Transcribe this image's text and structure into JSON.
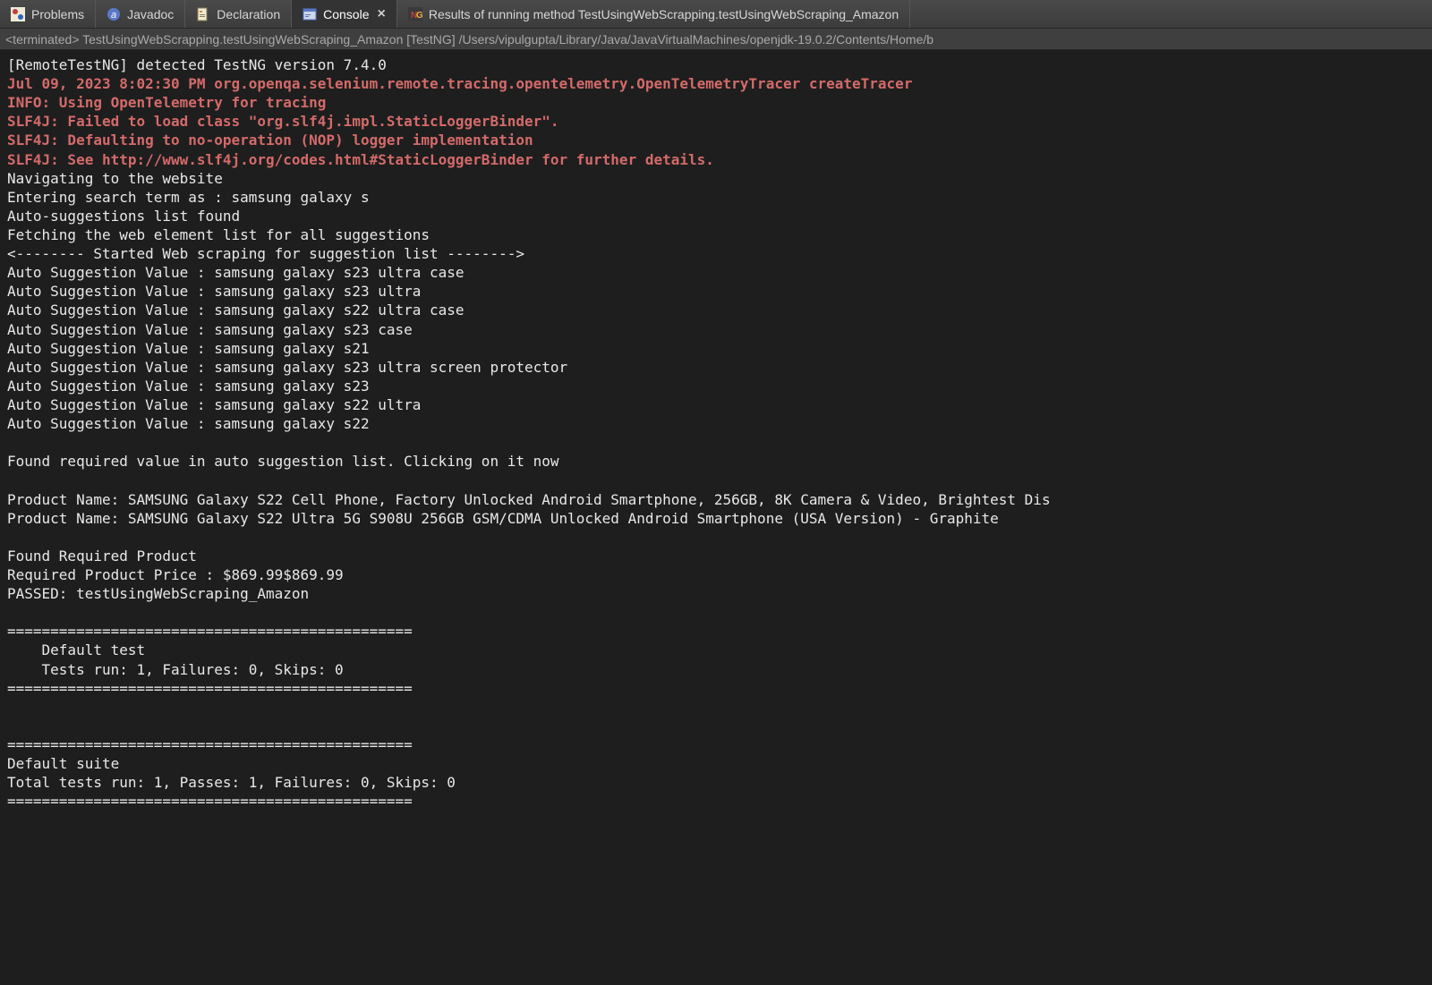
{
  "tabs": {
    "problems": {
      "label": "Problems"
    },
    "javadoc": {
      "label": "Javadoc"
    },
    "declaration": {
      "label": "Declaration"
    },
    "console": {
      "label": "Console"
    },
    "results": {
      "label": "Results of running method TestUsingWebScrapping.testUsingWebScraping_Amazon"
    }
  },
  "status": "<terminated> TestUsingWebScrapping.testUsingWebScraping_Amazon [TestNG] /Users/vipulgupta/Library/Java/JavaVirtualMachines/openjdk-19.0.2/Contents/Home/b",
  "console": {
    "lines": [
      {
        "cls": "white",
        "text": "[RemoteTestNG] detected TestNG version 7.4.0"
      },
      {
        "cls": "red",
        "text": "Jul 09, 2023 8:02:30 PM org.openqa.selenium.remote.tracing.opentelemetry.OpenTelemetryTracer createTracer"
      },
      {
        "cls": "red",
        "text": "INFO: Using OpenTelemetry for tracing"
      },
      {
        "cls": "red",
        "text": "SLF4J: Failed to load class \"org.slf4j.impl.StaticLoggerBinder\"."
      },
      {
        "cls": "red",
        "text": "SLF4J: Defaulting to no-operation (NOP) logger implementation"
      },
      {
        "cls": "red",
        "text": "SLF4J: See http://www.slf4j.org/codes.html#StaticLoggerBinder for further details."
      },
      {
        "cls": "white",
        "text": "Navigating to the website"
      },
      {
        "cls": "white",
        "text": "Entering search term as : samsung galaxy s"
      },
      {
        "cls": "white",
        "text": "Auto-suggestions list found"
      },
      {
        "cls": "white",
        "text": "Fetching the web element list for all suggestions"
      },
      {
        "cls": "white",
        "text": "<-------- Started Web scraping for suggestion list -------->"
      },
      {
        "cls": "white",
        "text": "Auto Suggestion Value : samsung galaxy s23 ultra case"
      },
      {
        "cls": "white",
        "text": "Auto Suggestion Value : samsung galaxy s23 ultra"
      },
      {
        "cls": "white",
        "text": "Auto Suggestion Value : samsung galaxy s22 ultra case"
      },
      {
        "cls": "white",
        "text": "Auto Suggestion Value : samsung galaxy s23 case"
      },
      {
        "cls": "white",
        "text": "Auto Suggestion Value : samsung galaxy s21"
      },
      {
        "cls": "white",
        "text": "Auto Suggestion Value : samsung galaxy s23 ultra screen protector"
      },
      {
        "cls": "white",
        "text": "Auto Suggestion Value : samsung galaxy s23"
      },
      {
        "cls": "white",
        "text": "Auto Suggestion Value : samsung galaxy s22 ultra"
      },
      {
        "cls": "white",
        "text": "Auto Suggestion Value : samsung galaxy s22"
      },
      {
        "cls": "white",
        "text": ""
      },
      {
        "cls": "white",
        "text": "Found required value in auto suggestion list. Clicking on it now"
      },
      {
        "cls": "white",
        "text": ""
      },
      {
        "cls": "white",
        "text": "Product Name: SAMSUNG Galaxy S22 Cell Phone, Factory Unlocked Android Smartphone, 256GB, 8K Camera & Video, Brightest Dis"
      },
      {
        "cls": "white",
        "text": "Product Name: SAMSUNG Galaxy S22 Ultra 5G S908U 256GB GSM/CDMA Unlocked Android Smartphone (USA Version) - Graphite"
      },
      {
        "cls": "white",
        "text": ""
      },
      {
        "cls": "white",
        "text": "Found Required Product"
      },
      {
        "cls": "white",
        "text": "Required Product Price : $869.99$869.99"
      },
      {
        "cls": "white",
        "text": "PASSED: testUsingWebScraping_Amazon"
      },
      {
        "cls": "white",
        "text": ""
      },
      {
        "cls": "white",
        "text": "==============================================="
      },
      {
        "cls": "white",
        "text": "    Default test"
      },
      {
        "cls": "white",
        "text": "    Tests run: 1, Failures: 0, Skips: 0"
      },
      {
        "cls": "white",
        "text": "==============================================="
      },
      {
        "cls": "white",
        "text": ""
      },
      {
        "cls": "white",
        "text": ""
      },
      {
        "cls": "white",
        "text": "==============================================="
      },
      {
        "cls": "white",
        "text": "Default suite"
      },
      {
        "cls": "white",
        "text": "Total tests run: 1, Passes: 1, Failures: 0, Skips: 0"
      },
      {
        "cls": "white",
        "text": "==============================================="
      }
    ]
  }
}
